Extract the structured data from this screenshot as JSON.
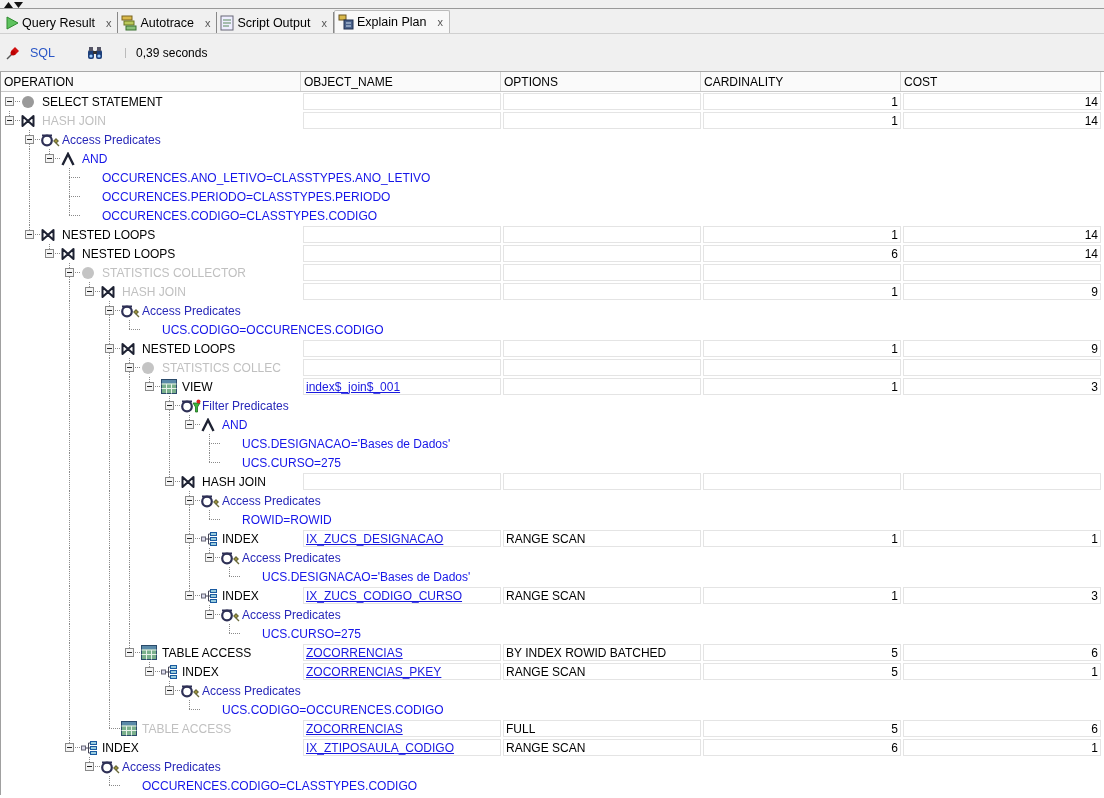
{
  "tabs": [
    {
      "label": "Query Result",
      "kind": "play",
      "selected": false,
      "close": "x"
    },
    {
      "label": "Autotrace",
      "kind": "autotrace",
      "selected": false,
      "close": "x"
    },
    {
      "label": "Script Output",
      "kind": "script",
      "selected": false,
      "close": "x"
    },
    {
      "label": "Explain Plan",
      "kind": "plan",
      "selected": true,
      "close": "x"
    }
  ],
  "toolbar": {
    "sql_link": "SQL",
    "elapsed": "0,39 seconds"
  },
  "plan": {
    "columns": [
      "OPERATION",
      "OBJECT_NAME",
      "OPTIONS",
      "CARDINALITY",
      "COST"
    ],
    "rows": [
      {
        "kind": "statement",
        "label": "SELECT STATEMENT",
        "cardinality": "1",
        "cost": "14",
        "expanded": true,
        "children": [
          {
            "kind": "join",
            "label": "HASH JOIN",
            "inactive": true,
            "cardinality": "1",
            "cost": "14",
            "expanded": true,
            "children": [
              {
                "kind": "access",
                "label": "Access Predicates",
                "expanded": true,
                "children": [
                  {
                    "kind": "and",
                    "label": "AND",
                    "expanded": true,
                    "children": [
                      {
                        "kind": "condition",
                        "label": "OCCURENCES.ANO_LETIVO=CLASSTYPES.ANO_LETIVO"
                      },
                      {
                        "kind": "condition",
                        "label": "OCCURENCES.PERIODO=CLASSTYPES.PERIODO"
                      },
                      {
                        "kind": "condition",
                        "label": "OCCURENCES.CODIGO=CLASSTYPES.CODIGO"
                      }
                    ]
                  }
                ]
              },
              {
                "kind": "join",
                "label": "NESTED LOOPS",
                "cardinality": "1",
                "cost": "14",
                "expanded": true,
                "children": [
                  {
                    "kind": "join",
                    "label": "NESTED LOOPS",
                    "cardinality": "6",
                    "cost": "14",
                    "expanded": true,
                    "children": [
                      {
                        "kind": "collector",
                        "label": "STATISTICS COLLECTOR",
                        "inactive": true,
                        "expanded": true,
                        "children": [
                          {
                            "kind": "join",
                            "label": "HASH JOIN",
                            "inactive": true,
                            "cardinality": "1",
                            "cost": "9",
                            "expanded": true,
                            "children": [
                              {
                                "kind": "access",
                                "label": "Access Predicates",
                                "expanded": true,
                                "children": [
                                  {
                                    "kind": "condition",
                                    "label": "UCS.CODIGO=OCCURENCES.CODIGO"
                                  }
                                ]
                              },
                              {
                                "kind": "join",
                                "label": "NESTED LOOPS",
                                "cardinality": "1",
                                "cost": "9",
                                "expanded": true,
                                "children": [
                                  {
                                    "kind": "collector",
                                    "label": "STATISTICS COLLEC",
                                    "inactive": true,
                                    "expanded": true,
                                    "children": [
                                      {
                                        "kind": "view",
                                        "label": "VIEW",
                                        "object_name": "index$_join$_001",
                                        "cardinality": "1",
                                        "cost": "3",
                                        "expanded": true,
                                        "children": [
                                          {
                                            "kind": "filter",
                                            "label": "Filter Predicates",
                                            "expanded": true,
                                            "children": [
                                              {
                                                "kind": "and",
                                                "label": "AND",
                                                "expanded": true,
                                                "children": [
                                                  {
                                                    "kind": "condition",
                                                    "label": "UCS.DESIGNACAO='Bases de Dados'"
                                                  },
                                                  {
                                                    "kind": "condition",
                                                    "label": "UCS.CURSO=275"
                                                  }
                                                ]
                                              }
                                            ]
                                          },
                                          {
                                            "kind": "join",
                                            "label": "HASH JOIN",
                                            "expanded": true,
                                            "children": [
                                              {
                                                "kind": "access",
                                                "label": "Access Predicates",
                                                "expanded": true,
                                                "children": [
                                                  {
                                                    "kind": "condition",
                                                    "label": "ROWID=ROWID"
                                                  }
                                                ]
                                              },
                                              {
                                                "kind": "index",
                                                "label": "INDEX",
                                                "object_name": "IX_ZUCS_DESIGNACAO",
                                                "options": "RANGE SCAN",
                                                "cardinality": "1",
                                                "cost": "1",
                                                "expanded": true,
                                                "children": [
                                                  {
                                                    "kind": "access",
                                                    "label": "Access Predicates",
                                                    "expanded": true,
                                                    "children": [
                                                      {
                                                        "kind": "condition",
                                                        "label": "UCS.DESIGNACAO='Bases de Dados'"
                                                      }
                                                    ]
                                                  }
                                                ]
                                              },
                                              {
                                                "kind": "index",
                                                "label": "INDEX",
                                                "object_name": "IX_ZUCS_CODIGO_CURSO",
                                                "options": "RANGE SCAN",
                                                "cardinality": "1",
                                                "cost": "3",
                                                "expanded": true,
                                                "children": [
                                                  {
                                                    "kind": "access",
                                                    "label": "Access Predicates",
                                                    "expanded": true,
                                                    "children": [
                                                      {
                                                        "kind": "condition",
                                                        "label": "UCS.CURSO=275"
                                                      }
                                                    ]
                                                  }
                                                ]
                                              }
                                            ]
                                          }
                                        ]
                                      }
                                    ]
                                  },
                                  {
                                    "kind": "table",
                                    "label": "TABLE ACCESS",
                                    "object_name": "ZOCORRENCIAS",
                                    "options": "BY INDEX ROWID BATCHED",
                                    "cardinality": "5",
                                    "cost": "6",
                                    "expanded": true,
                                    "children": [
                                      {
                                        "kind": "index",
                                        "label": "INDEX",
                                        "object_name": "ZOCORRENCIAS_PKEY",
                                        "options": "RANGE SCAN",
                                        "cardinality": "5",
                                        "cost": "1",
                                        "expanded": true,
                                        "children": [
                                          {
                                            "kind": "access",
                                            "label": "Access Predicates",
                                            "expanded": true,
                                            "children": [
                                              {
                                                "kind": "condition",
                                                "label": "UCS.CODIGO=OCCURENCES.CODIGO"
                                              }
                                            ]
                                          }
                                        ]
                                      }
                                    ]
                                  }
                                ]
                              },
                              {
                                "kind": "table",
                                "label": "TABLE ACCESS",
                                "inactive": true,
                                "object_name": "ZOCORRENCIAS",
                                "options": "FULL",
                                "cardinality": "5",
                                "cost": "6"
                              }
                            ]
                          }
                        ]
                      },
                      {
                        "kind": "index",
                        "label": "INDEX",
                        "object_name": "IX_ZTIPOSAULA_CODIGO",
                        "options": "RANGE SCAN",
                        "cardinality": "6",
                        "cost": "1",
                        "expanded": true,
                        "children": [
                          {
                            "kind": "access",
                            "label": "Access Predicates",
                            "expanded": true,
                            "children": [
                              {
                                "kind": "condition",
                                "label": "OCCURENCES.CODIGO=CLASSTYPES.CODIGO"
                              }
                            ]
                          }
                        ]
                      }
                    ]
                  }
                ]
              }
            ]
          }
        ]
      }
    ]
  }
}
